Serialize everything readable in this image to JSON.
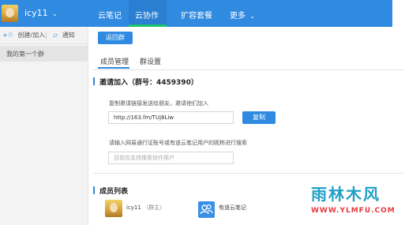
{
  "header": {
    "username": "icy11",
    "nav": [
      {
        "label": "云笔记"
      },
      {
        "label": "云协作"
      },
      {
        "label": "扩容套餐"
      },
      {
        "label": "更多"
      }
    ],
    "active_nav": "云协作"
  },
  "sidebar": {
    "create_join_label": "创建/加入",
    "notify_label": "通知",
    "groups": [
      {
        "name": "我的第一个群"
      }
    ]
  },
  "main": {
    "back_button": "返回群",
    "tabs": [
      {
        "label": "成员管理"
      },
      {
        "label": "群设置"
      }
    ],
    "invite": {
      "title": "邀请加入（群号：4459390）",
      "link_hint": "复制邀请链接发送给朋友，邀请他们加入",
      "link_value": "http://163.fm/TUj8Liw",
      "copy_button": "复制",
      "search_hint": "请输入网易通行证账号或有道云笔记用户的昵称进行搜索",
      "search_placeholder": "目前仅支持搜索协作用户"
    },
    "members": {
      "title": "成员列表",
      "items": [
        {
          "name": "icy11",
          "role": "（群主）"
        },
        {
          "name": "有道云笔记",
          "role": ""
        }
      ]
    }
  },
  "watermark": {
    "main": "雨林木风",
    "sub": "WWW.YLMFU.COM"
  },
  "colors": {
    "accent": "#2f8ae0",
    "active_underline": "#1cc36d"
  }
}
